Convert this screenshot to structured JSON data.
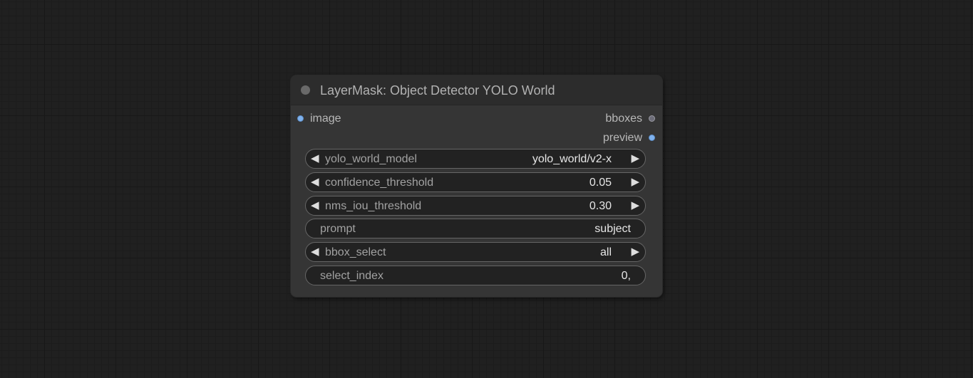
{
  "node": {
    "title": "LayerMask: Object Detector YOLO World",
    "inputs": [
      {
        "label": "image",
        "color": "#7fb2ee"
      }
    ],
    "outputs": [
      {
        "label": "bboxes",
        "color": "#6c6c78"
      },
      {
        "label": "preview",
        "color": "#7fb2ee"
      }
    ],
    "widgets": [
      {
        "label": "yolo_world_model",
        "value": "yolo_world/v2-x",
        "kind": "combo"
      },
      {
        "label": "confidence_threshold",
        "value": "0.05",
        "kind": "number"
      },
      {
        "label": "nms_iou_threshold",
        "value": "0.30",
        "kind": "number"
      },
      {
        "label": "prompt",
        "value": "subject",
        "kind": "text"
      },
      {
        "label": "bbox_select",
        "value": "all",
        "kind": "combo"
      },
      {
        "label": "select_index",
        "value": "0,",
        "kind": "text"
      }
    ],
    "arrows": {
      "left": "◀",
      "right": "▶"
    }
  }
}
